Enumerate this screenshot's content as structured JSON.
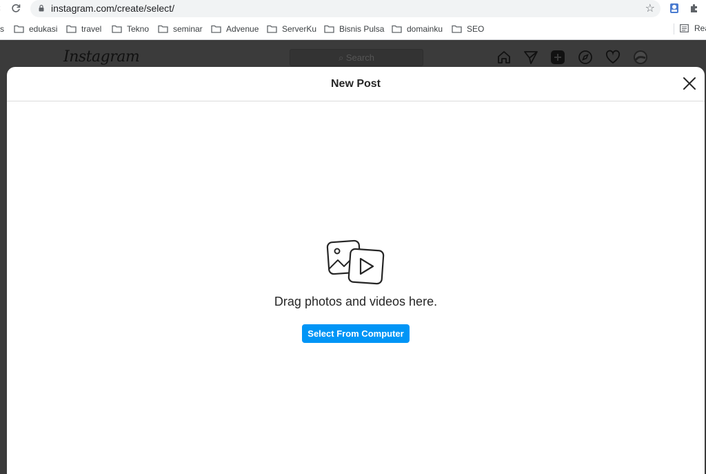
{
  "browser": {
    "url": "instagram.com/create/select/",
    "icons": {
      "back": "back-arrow-icon",
      "reload": "reload-icon",
      "lock": "lock-icon",
      "bookmark": "star-icon",
      "profile": "profile-extension-icon",
      "extensions": "puzzle-icon"
    },
    "bookmarks": [
      {
        "label": "s"
      },
      {
        "label": "edukasi"
      },
      {
        "label": "travel"
      },
      {
        "label": "Tekno"
      },
      {
        "label": "seminar"
      },
      {
        "label": "Advenue"
      },
      {
        "label": "ServerKu"
      },
      {
        "label": "Bisnis Pulsa"
      },
      {
        "label": "domainku"
      },
      {
        "label": "SEO"
      }
    ],
    "reading_list_label": "Rea"
  },
  "instagram": {
    "logo": "Instagram",
    "search_placeholder": "Search",
    "nav_icons": [
      "home-icon",
      "direct-icon",
      "new-post-icon",
      "explore-icon",
      "activity-icon",
      "profile-avatar"
    ]
  },
  "modal": {
    "title": "New Post",
    "drag_text": "Drag photos and videos here.",
    "select_button": "Select From Computer"
  },
  "colors": {
    "accent": "#0095f6",
    "overlay": "#3b3b3b"
  }
}
